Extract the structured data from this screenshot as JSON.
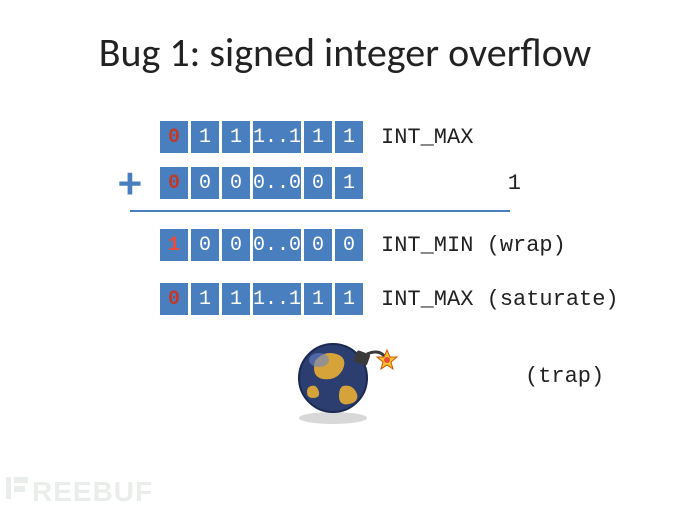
{
  "title": "Bug 1: signed integer overflow",
  "rows": {
    "intmax": {
      "bits": [
        "0",
        "1",
        "1",
        "1..1",
        "1",
        "1"
      ],
      "signClass": "sign0",
      "label": "INT_MAX"
    },
    "one": {
      "bits": [
        "0",
        "0",
        "0",
        "0..0",
        "0",
        "1"
      ],
      "signClass": "sign0",
      "label": "1"
    },
    "wrap": {
      "bits": [
        "1",
        "0",
        "0",
        "0..0",
        "0",
        "0"
      ],
      "signClass": "sign1",
      "label": "INT_MIN (wrap)"
    },
    "saturate": {
      "bits": [
        "0",
        "1",
        "1",
        "1..1",
        "1",
        "1"
      ],
      "signClass": "sign0",
      "label": "INT_MAX (saturate)"
    }
  },
  "plus": "+",
  "trap_label": "(trap)",
  "watermark": "REEBUF"
}
